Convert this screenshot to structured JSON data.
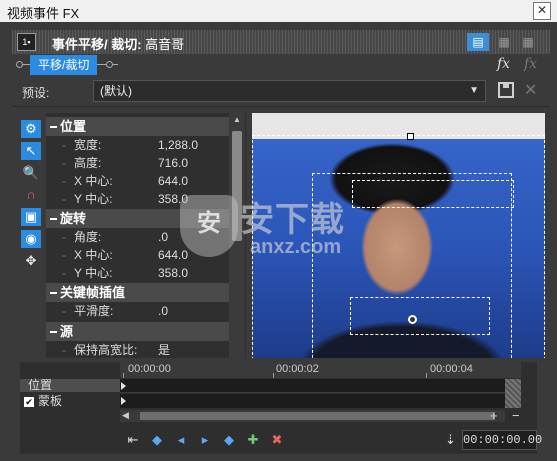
{
  "window": {
    "title": "视频事件 FX",
    "close_glyph": "✕"
  },
  "header": {
    "fx_icon_text": "1▪",
    "title_bold": "事件平移/ 裁切:",
    "title_name": " 高音哥",
    "view_buttons": [
      "▤",
      "▦",
      "▦"
    ]
  },
  "chain": {
    "tab_label": "平移/裁切",
    "fx_button": "fx",
    "fx_button2": "fx"
  },
  "preset": {
    "label": "预设:",
    "value": "(默认)",
    "arrow": "▼",
    "delete_glyph": "✕"
  },
  "toolbar": {
    "tools": [
      "⚙",
      "↖",
      "🔍",
      "∩",
      "▣",
      "◉",
      "✥"
    ]
  },
  "properties": {
    "sections": [
      {
        "title": "位置",
        "rows": [
          {
            "label": "宽度:",
            "value": "1,288.0"
          },
          {
            "label": "高度:",
            "value": "716.0"
          },
          {
            "label": "X 中心:",
            "value": "644.0"
          },
          {
            "label": "Y 中心:",
            "value": "358.0"
          }
        ]
      },
      {
        "title": "旋转",
        "rows": [
          {
            "label": "角度:",
            "value": ".0"
          },
          {
            "label": "X 中心:",
            "value": "644.0"
          },
          {
            "label": "Y 中心:",
            "value": "358.0"
          }
        ]
      },
      {
        "title": "关键帧插值",
        "rows": [
          {
            "label": "平滑度:",
            "value": ".0"
          }
        ]
      },
      {
        "title": "源",
        "rows": [
          {
            "label": "保持高宽比:",
            "value": "是"
          }
        ]
      }
    ],
    "scroll_up": "▲"
  },
  "timeline": {
    "ticks": [
      "00:00:00",
      "00:00:02",
      "00:00:04"
    ],
    "tracks": [
      {
        "label": "位置"
      },
      {
        "label": "蒙板",
        "checked": true,
        "check_glyph": "✔"
      }
    ],
    "hscroll_left": "◀",
    "zoom_in": "+",
    "zoom_out": "−",
    "keyframe_buttons": [
      "⇤",
      "◆",
      "◂",
      "▸",
      "◆",
      "✚",
      "✖"
    ],
    "time_pin": "⇣",
    "time": "00:00:00.00"
  },
  "watermark": {
    "shield": "安",
    "text": "安下载",
    "sub": "anxz.com"
  }
}
